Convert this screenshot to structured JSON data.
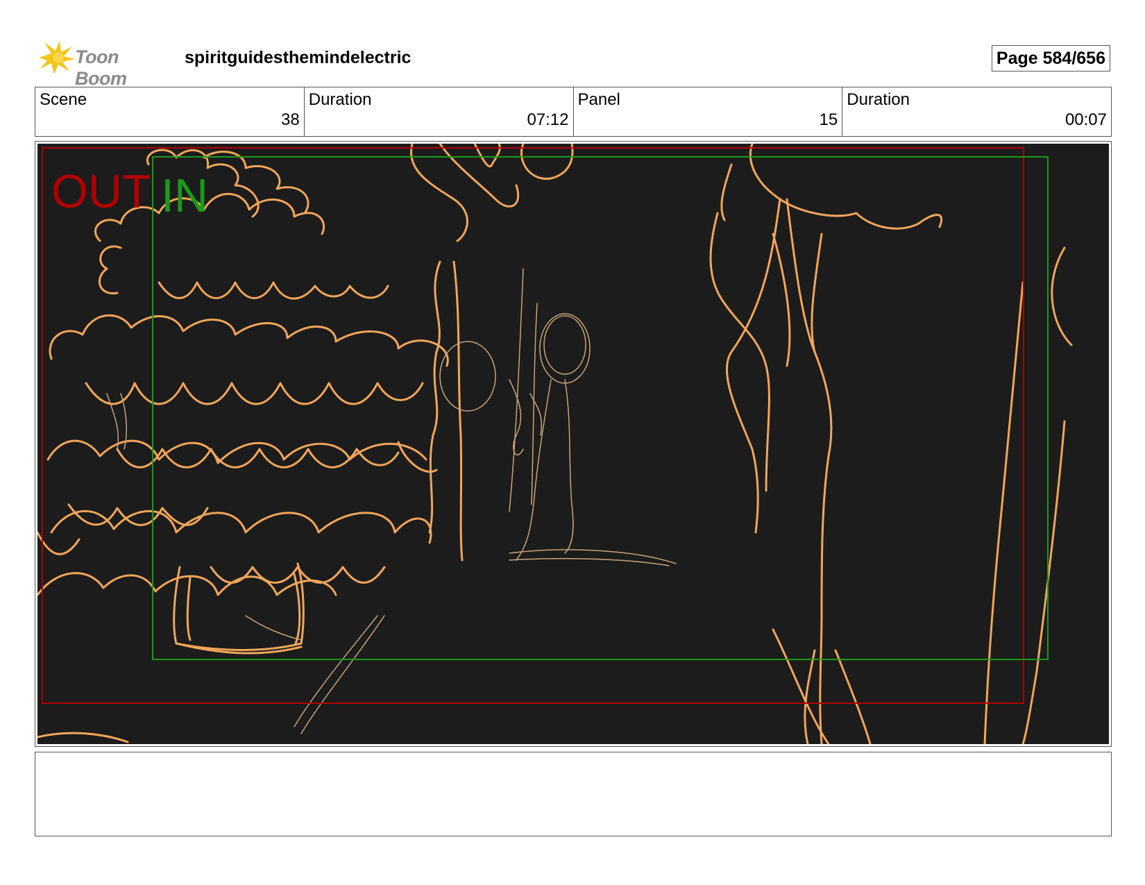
{
  "header": {
    "logo_text": "Toon Boom",
    "project_title": "spiritguidesthemindelectric",
    "page_label": "Page 584/656"
  },
  "info": {
    "scene_label": "Scene",
    "scene_value": "38",
    "scene_duration_label": "Duration",
    "scene_duration_value": "07:12",
    "panel_label": "Panel",
    "panel_value": "15",
    "panel_duration_label": "Duration",
    "panel_duration_value": "00:07"
  },
  "panel": {
    "out_label": "OUT",
    "in_label": "IN",
    "colors": {
      "background": "#1c1c1c",
      "sketch": "#f2a65a",
      "out_frame": "#b00000",
      "in_frame": "#1a9a1a"
    }
  },
  "notes": {
    "text": ""
  }
}
